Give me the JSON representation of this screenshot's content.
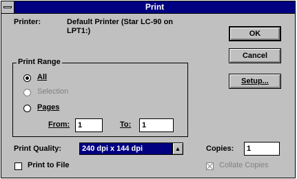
{
  "window": {
    "title": "Print"
  },
  "printer": {
    "label": "Printer:",
    "value_line1": "Default Printer (Star  LC-90 on",
    "value_line2": "LPT1:)"
  },
  "buttons": {
    "ok": "OK",
    "cancel": "Cancel",
    "setup": "Setup..."
  },
  "print_range": {
    "legend": "Print Range",
    "options": [
      {
        "label": "All",
        "selected": true,
        "enabled": true
      },
      {
        "label": "Selection",
        "selected": false,
        "enabled": false
      },
      {
        "label": "Pages",
        "selected": false,
        "enabled": true
      }
    ],
    "from_label": "From:",
    "from_value": "1",
    "to_label": "To:",
    "to_value": "1"
  },
  "print_quality": {
    "label": "Print Quality:",
    "value": "240 dpi x 144 dpi"
  },
  "copies": {
    "label": "Copies:",
    "value": "1"
  },
  "print_to_file": {
    "label": "Print to File",
    "checked": false
  },
  "collate": {
    "label": "Collate Copies",
    "checked": true,
    "enabled": false
  },
  "icons": {
    "system_menu": "system-menu-icon",
    "dropdown": "dropdown-arrow-icon"
  }
}
